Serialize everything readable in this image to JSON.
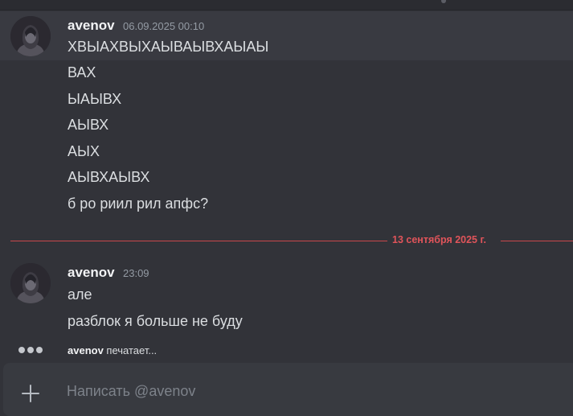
{
  "messages": [
    {
      "author": "avenov",
      "timestamp": "06.09.2025 00:10",
      "lines": [
        "ХВЫАХВЫХАЫВАЫВХАЫАЫ",
        "ВАХ",
        "ЫАЫВХ",
        "АЫВХ",
        "АЫХ",
        "АЫВХАЫВХ",
        "б ро риил рил апфс?"
      ]
    },
    {
      "author": "avenov",
      "timestamp": "23:09",
      "lines": [
        "але",
        "разблок я больше не буду"
      ]
    }
  ],
  "date_divider": "13 сентября 2025 г.",
  "typing": {
    "user": "avenov",
    "text": " печатает..."
  },
  "composer": {
    "placeholder": "Написать @avenov",
    "value": ""
  },
  "colors": {
    "background": "#323339",
    "divider": "#e0545a",
    "composer": "#383a40"
  }
}
